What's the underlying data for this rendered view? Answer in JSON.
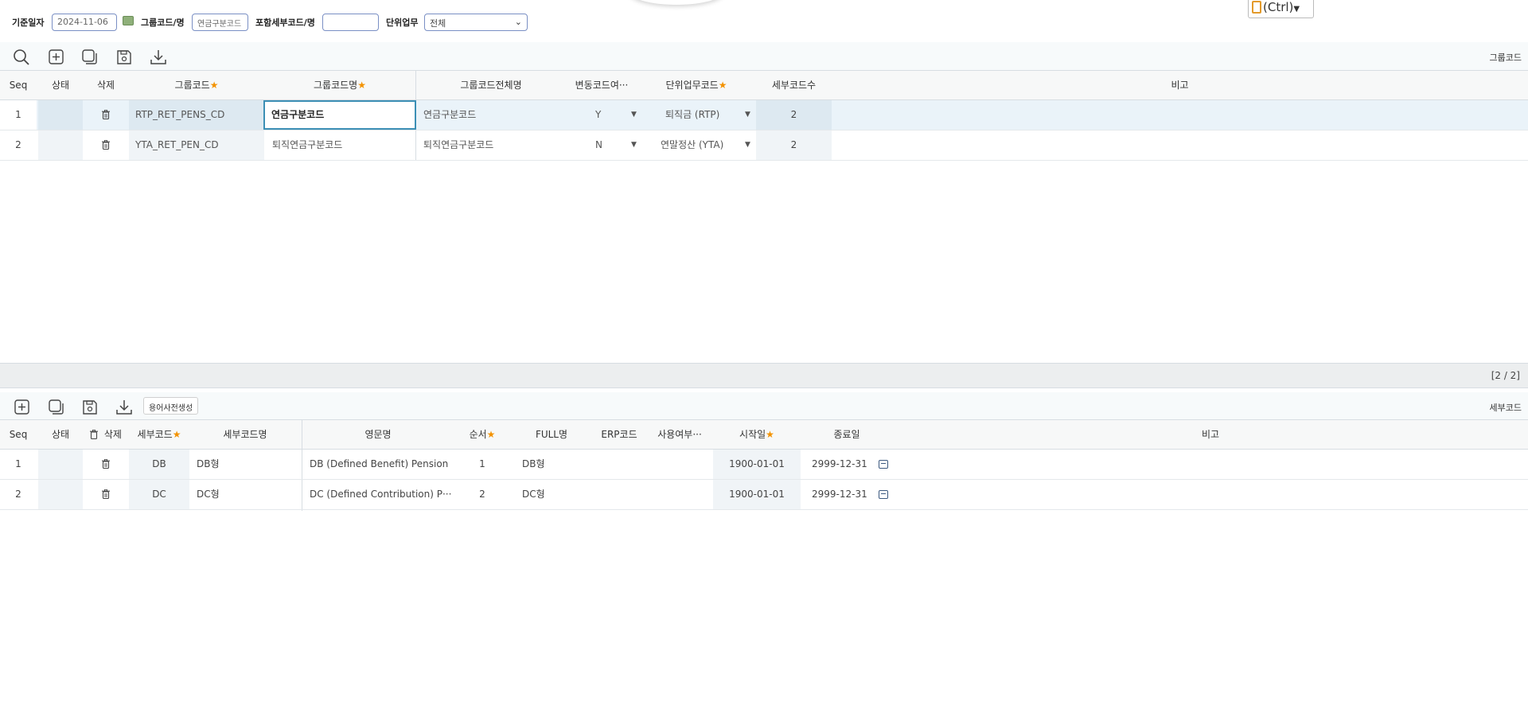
{
  "filter": {
    "base_date_label": "기준일자",
    "base_date_value": "2024-11-06",
    "group_code_label": "그룹코드/명",
    "group_code_value": "연금구분코드",
    "detail_code_label": "포함세부코드/명",
    "detail_code_value": "",
    "unit_work_label": "단위업무",
    "unit_work_value": "전체"
  },
  "ctrl_popup": {
    "label": "(Ctrl)"
  },
  "upper_grid": {
    "title": "그룹코드",
    "pager": "[2 / 2]",
    "headers": {
      "seq": "Seq",
      "status": "상태",
      "delete": "삭제",
      "group_code": "그룹코드",
      "group_name": "그룹코드명",
      "group_full_name": "그룹코드전체명",
      "variable": "변동코드여···",
      "unit_work_code": "단위업무코드",
      "detail_count": "세부코드수",
      "remark": "비고"
    },
    "rows": [
      {
        "seq": "1",
        "group_code": "RTP_RET_PENS_CD",
        "group_name": "연금구분코드",
        "group_full_name": "연금구분코드",
        "variable": "Y",
        "unit_work_code": "퇴직금 (RTP)",
        "detail_count": "2"
      },
      {
        "seq": "2",
        "group_code": "YTA_RET_PEN_CD",
        "group_name": "퇴직연금구분코드",
        "group_full_name": "퇴직연금구분코드",
        "variable": "N",
        "unit_work_code": "연말정산 (YTA)",
        "detail_count": "2"
      }
    ]
  },
  "lower_grid": {
    "title": "세부코드",
    "dictionary_button": "용어사전생성",
    "headers": {
      "seq": "Seq",
      "status": "상태",
      "delete": "삭제",
      "detail_code": "세부코드",
      "detail_name": "세부코드명",
      "english_name": "영문명",
      "order": "순서",
      "full_name": "FULL명",
      "erp_code": "ERP코드",
      "use_yn": "사용여부···",
      "start_date": "시작일",
      "end_date": "종료일",
      "remark": "비고"
    },
    "rows": [
      {
        "seq": "1",
        "detail_code": "DB",
        "detail_name": "DB형",
        "english_name": "DB (Defined Benefit) Pension",
        "order": "1",
        "full_name": "DB형",
        "start_date": "1900-01-01",
        "end_date": "2999-12-31"
      },
      {
        "seq": "2",
        "detail_code": "DC",
        "detail_name": "DC형",
        "english_name": "DC (Defined Contribution) P···",
        "order": "2",
        "full_name": "DC형",
        "start_date": "1900-01-01",
        "end_date": "2999-12-31"
      }
    ]
  },
  "icons": {
    "search": "search-icon",
    "add": "add-icon",
    "copy": "copy-icon",
    "save": "save-icon",
    "download": "download-icon",
    "trash": "trash-icon",
    "calendar": "calendar-icon"
  },
  "colors": {
    "required": "#f39200",
    "input_border": "#7a8fc4",
    "edit_border": "#3c8fb5"
  }
}
